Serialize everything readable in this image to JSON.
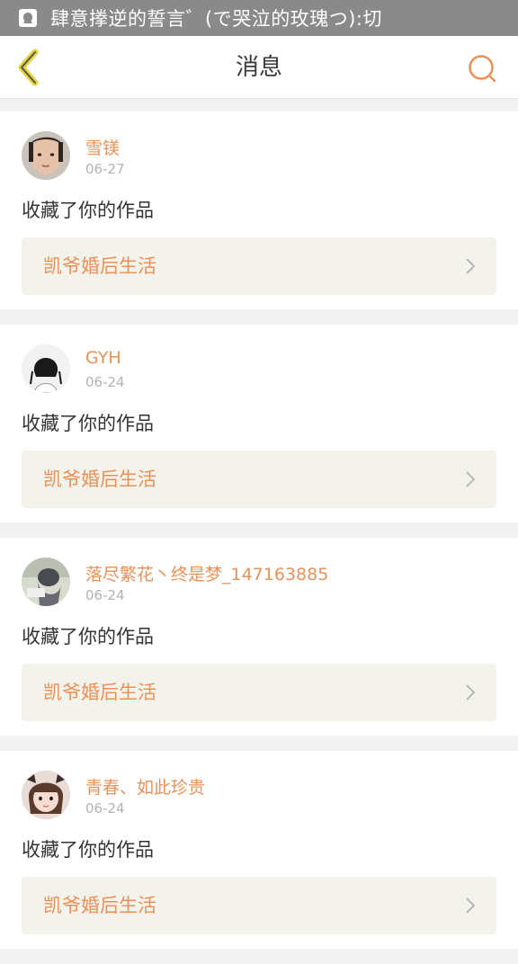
{
  "status_bar": {
    "text": "肆意搼逆的誓言゛(で哭泣的玫瑰つ):切",
    "bg_color": "#8a8a8a"
  },
  "header": {
    "title": "消息",
    "accent_color": "#e8925a"
  },
  "messages": [
    {
      "username": "雪镁",
      "date": "06-27",
      "action": "收藏了你的作品",
      "work_title": "凯爷婚后生活"
    },
    {
      "username": "GYH",
      "date": "06-24",
      "action": "收藏了你的作品",
      "work_title": "凯爷婚后生活"
    },
    {
      "username": "落尽繁花丶终是梦_147163885",
      "date": "06-24",
      "action": "收藏了你的作品",
      "work_title": "凯爷婚后生活"
    },
    {
      "username": "青春、如此珍贵",
      "date": "06-24",
      "action": "收藏了你的作品",
      "work_title": "凯爷婚后生活"
    }
  ],
  "icons": {
    "status": "notification-icon",
    "back": "back-chevron-icon",
    "search": "search-icon",
    "row": "chevron-right-icon"
  }
}
